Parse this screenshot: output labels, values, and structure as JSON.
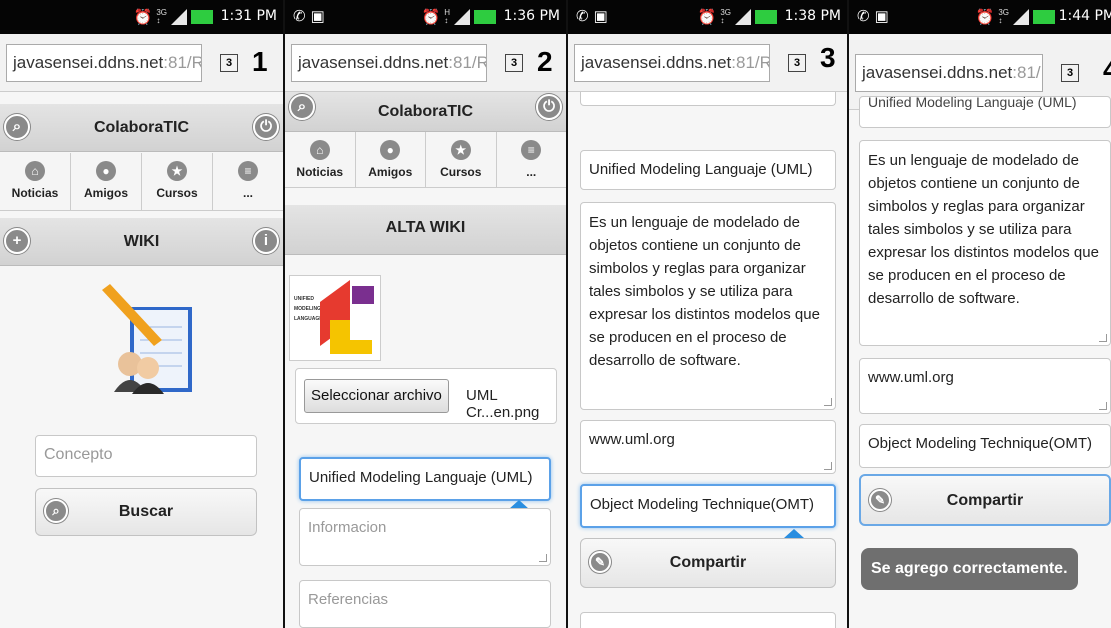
{
  "panels": [
    {
      "time": "1:31 PM",
      "num": "1",
      "url_host": "javasensei.ddns.net",
      "url_rest": ":81/R",
      "tabs": "3"
    },
    {
      "time": "1:36 PM",
      "num": "2",
      "url_host": "javasensei.ddns.net",
      "url_rest": ":81/R",
      "tabs": "3"
    },
    {
      "time": "1:38 PM",
      "num": "3",
      "url_host": "javasensei.ddns.net",
      "url_rest": ":81/R",
      "tabs": "3"
    },
    {
      "time": "1:44 PM",
      "num": "4",
      "url_host": "javasensei.ddns.net",
      "url_rest": ":81/R",
      "tabs": "3"
    }
  ],
  "app_title": "ColaboraTIC",
  "nav": [
    "Noticias",
    "Amigos",
    "Cursos",
    "..."
  ],
  "wiki_title": "WIKI",
  "alta_title": "ALTA WIKI",
  "search": {
    "placeholder": "Concepto",
    "button": "Buscar"
  },
  "form": {
    "file_button": "Seleccionar archivo",
    "file_name": "UML Cr...en.png",
    "logo_text": [
      "UNIFIED",
      "MODELING",
      "LANGUAGE"
    ],
    "concept": "Unified Modeling Languaje (UML)",
    "info_placeholder": "Informacion",
    "refs_placeholder": "Referencias",
    "info": "Es un lenguaje de modelado de objetos contiene un conjunto de simbolos y reglas para organizar tales simbolos y se utiliza para expresar los distintos modelos que se producen en el proceso de desarrollo de software.",
    "refs": "www.uml.org",
    "related": "Object Modeling Technique(OMT)",
    "share": "Compartir",
    "concept_cut": "Unified Modeling Languaje (UML)"
  },
  "toast": "Se agrego correctamente.",
  "colors": {
    "accent": "#5ba1e8",
    "handle": "#2a8ee0",
    "statusbar": "#050505",
    "battery": "#2ecc40"
  }
}
